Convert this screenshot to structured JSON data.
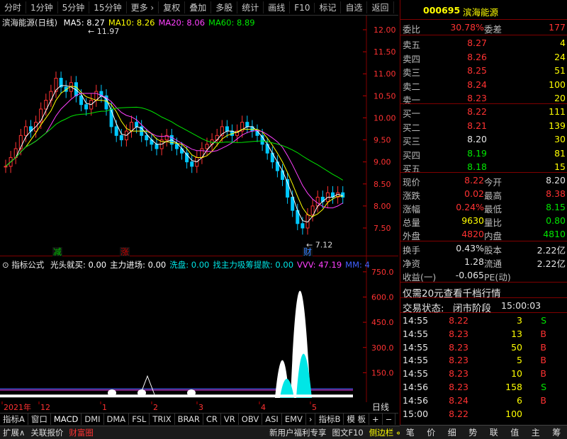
{
  "toolbar": [
    "分时",
    "1分钟",
    "5分钟",
    "15分钟",
    "更多 ›",
    "复权",
    "叠加",
    "多股",
    "统计",
    "画线",
    "F10",
    "标记",
    "自选",
    "返回"
  ],
  "chart": {
    "name": "滨海能源",
    "period": "(日线)",
    "ma": [
      {
        "label": "MA5: 8.27",
        "color": "#ffffff"
      },
      {
        "label": "MA10: 8.26",
        "color": "#ffff00"
      },
      {
        "label": "MA20: 8.06",
        "color": "#ff40ff"
      },
      {
        "label": "MA60: 8.89",
        "color": "#00e600"
      }
    ],
    "yticks": [
      "12.00",
      "11.50",
      "11.00",
      "10.50",
      "10.00",
      "9.50",
      "9.00",
      "8.50",
      "8.00",
      "7.50"
    ],
    "high_label": "11.97",
    "low_label": "7.12",
    "marks": [
      {
        "text": "减",
        "color": "#00c000"
      },
      {
        "text": "涨",
        "color": "#c00000"
      },
      {
        "text": "财",
        "color": "#3080ff"
      }
    ]
  },
  "indicator": {
    "title": "指标公式",
    "items": [
      {
        "text": "光头就买: 0.00",
        "color": "#ffffff"
      },
      {
        "text": "主力进场: 0.00",
        "color": "#ffffff"
      },
      {
        "text": "洗盘: 0.00",
        "color": "#00e6e6"
      },
      {
        "text": "找主力吸筹提款: 0.00",
        "color": "#00e6e6"
      },
      {
        "text": "VVV: 47.19",
        "color": "#ff40ff"
      },
      {
        "text": "MM: 4",
        "color": "#4060ff"
      }
    ],
    "yticks": [
      "750.0",
      "600.0",
      "450.0",
      "300.0",
      "150.0"
    ]
  },
  "timeaxis": {
    "labels": [
      "2021年",
      "12",
      "1",
      "2",
      "3",
      "4",
      "5"
    ],
    "period": "日线"
  },
  "tabs": [
    "指标A",
    "窗口",
    "MACD",
    "DMI",
    "DMA",
    "FSL",
    "TRIX",
    "BRAR",
    "CR",
    "VR",
    "OBV",
    "ASI",
    "EMV",
    "›",
    "指标B",
    "模 板",
    "+",
    "−"
  ],
  "statusbar": {
    "left": [
      "扩展∧",
      "关联报价",
      "财富圈"
    ],
    "right": [
      "新用户福利专享",
      "图文F10",
      "侧边栏 «"
    ]
  },
  "quote": {
    "code": "000695",
    "name": "滨海能源",
    "weibi_label": "委比",
    "weibi": "30.78%",
    "weicha_label": "委差",
    "weicha": "177",
    "sell": [
      {
        "label": "卖五",
        "price": "8.27",
        "vol": "4"
      },
      {
        "label": "卖四",
        "price": "8.26",
        "vol": "24"
      },
      {
        "label": "卖三",
        "price": "8.25",
        "vol": "51"
      },
      {
        "label": "卖二",
        "price": "8.24",
        "vol": "100"
      },
      {
        "label": "卖一",
        "price": "8.23",
        "vol": "20"
      }
    ],
    "buy": [
      {
        "label": "买一",
        "price": "8.22",
        "vol": "111"
      },
      {
        "label": "买二",
        "price": "8.21",
        "vol": "139"
      },
      {
        "label": "买三",
        "price": "8.20",
        "vol": "30"
      },
      {
        "label": "买四",
        "price": "8.19",
        "vol": "81"
      },
      {
        "label": "买五",
        "price": "8.18",
        "vol": "15"
      }
    ],
    "stats": [
      {
        "l1": "现价",
        "v1": "8.22",
        "c1": "red",
        "l2": "今开",
        "v2": "8.20",
        "c2": "white"
      },
      {
        "l1": "涨跌",
        "v1": "0.02",
        "c1": "red",
        "l2": "最高",
        "v2": "8.38",
        "c2": "red"
      },
      {
        "l1": "涨幅",
        "v1": "0.24%",
        "c1": "red",
        "l2": "最低",
        "v2": "8.15",
        "c2": "green"
      },
      {
        "l1": "总量",
        "v1": "9630",
        "c1": "yellow",
        "l2": "量比",
        "v2": "0.80",
        "c2": "green"
      },
      {
        "l1": "外盘",
        "v1": "4820",
        "c1": "red",
        "l2": "内盘",
        "v2": "4810",
        "c2": "green"
      }
    ],
    "stats2": [
      {
        "l1": "换手",
        "v1": "0.43%",
        "l2": "股本",
        "v2": "2.22亿"
      },
      {
        "l1": "净资",
        "v1": "1.28",
        "l2": "流通",
        "v2": "2.22亿"
      },
      {
        "l1": "收益(一)",
        "v1": "-0.065",
        "l2": "PE(动)",
        "v2": ""
      }
    ],
    "promo": "仅需20元查看千档行情",
    "trade_state_label": "交易状态:",
    "trade_state": "闭市阶段",
    "trade_time": "15:00:03",
    "ticks": [
      {
        "t": "14:55",
        "p": "8.22",
        "v": "3",
        "s": "S"
      },
      {
        "t": "14:55",
        "p": "8.23",
        "v": "13",
        "s": "B"
      },
      {
        "t": "14:55",
        "p": "8.23",
        "v": "50",
        "s": "B"
      },
      {
        "t": "14:55",
        "p": "8.23",
        "v": "5",
        "s": "B"
      },
      {
        "t": "14:55",
        "p": "8.23",
        "v": "10",
        "s": "B"
      },
      {
        "t": "14:56",
        "p": "8.23",
        "v": "158",
        "s": "S"
      },
      {
        "t": "14:56",
        "p": "8.24",
        "v": "6",
        "s": "B"
      },
      {
        "t": "15:00",
        "p": "8.22",
        "v": "100",
        "s": ""
      }
    ]
  },
  "right_tabs": [
    "笔",
    "价",
    "细",
    "势",
    "联",
    "值",
    "主",
    "筹"
  ]
}
